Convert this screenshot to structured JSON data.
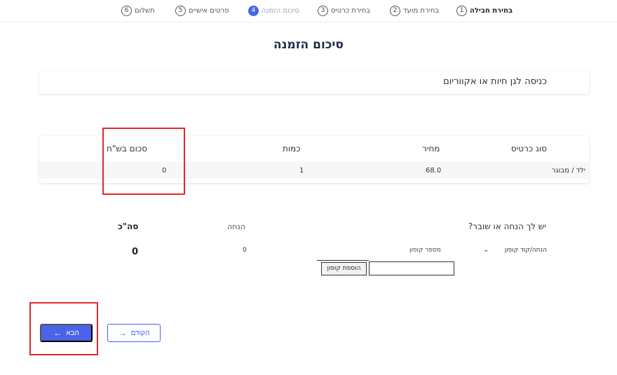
{
  "steps": [
    {
      "num": "1",
      "label": "בחירת חבילה"
    },
    {
      "num": "2",
      "label": "בחירת מועד"
    },
    {
      "num": "3",
      "label": "בחירת כרטיס"
    },
    {
      "num": "4",
      "label": "סיכום הזמנה"
    },
    {
      "num": "5",
      "label": "פרטים אישיים"
    },
    {
      "num": "6",
      "label": "תשלום"
    }
  ],
  "title": "סיכום הזמנה",
  "package_name": "כניסה לגן חיות או אקווריום",
  "table": {
    "headers": {
      "type": "סוג כרטיס",
      "price": "מחיר",
      "qty": "כמות",
      "sum": "סכום בש\"ח"
    },
    "rows": [
      {
        "type": "ילד / מבוגר",
        "price": "68.0",
        "qty": "1",
        "sum": "0"
      }
    ]
  },
  "coupon": {
    "question": "יש לך הנחה או שובר?",
    "discount_header": "הנחה",
    "total_header": "סה\"כ",
    "type_select": "הנחה/קוד קופון",
    "code_label": "מספר קופון",
    "discount_value": "0",
    "total_value": "0",
    "add_button": "הוספת קופון",
    "input_value": ""
  },
  "nav": {
    "next": "הבא",
    "prev": "הקודם"
  },
  "colors": {
    "accent": "#4a63e8",
    "highlight": "#e02a2a"
  }
}
